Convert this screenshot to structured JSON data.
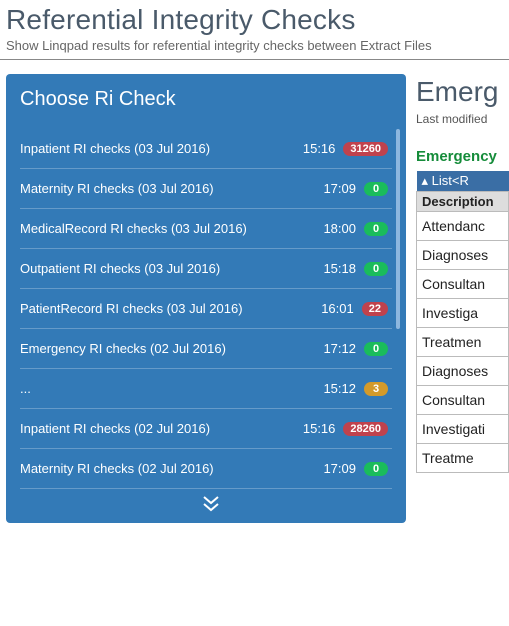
{
  "header": {
    "title": "Referential Integrity Checks",
    "subtitle": "Show Linqpad results for referential integrity checks between Extract Files"
  },
  "panel": {
    "title": "Choose Ri Check",
    "items": [
      {
        "label": "Inpatient RI checks (03 Jul 2016)",
        "time": "15:16",
        "count": "31260",
        "level": "red"
      },
      {
        "label": "Maternity RI checks (03 Jul 2016)",
        "time": "17:09",
        "count": "0",
        "level": "green"
      },
      {
        "label": "MedicalRecord RI checks (03 Jul 2016)",
        "time": "18:00",
        "count": "0",
        "level": "green"
      },
      {
        "label": "Outpatient RI checks (03 Jul 2016)",
        "time": "15:18",
        "count": "0",
        "level": "green"
      },
      {
        "label": "PatientRecord RI checks (03 Jul 2016)",
        "time": "16:01",
        "count": "22",
        "level": "red"
      },
      {
        "label": "Emergency RI checks (02 Jul 2016)",
        "time": "17:12",
        "count": "0",
        "level": "green"
      },
      {
        "label": "...",
        "time": "15:12",
        "count": "3",
        "level": "orange"
      },
      {
        "label": "Inpatient RI checks (02 Jul 2016)",
        "time": "15:16",
        "count": "28260",
        "level": "red"
      },
      {
        "label": "Maternity RI checks (02 Jul 2016)",
        "time": "17:09",
        "count": "0",
        "level": "green"
      }
    ]
  },
  "detail": {
    "title": "Emerg",
    "subtitle": "Last modified",
    "section": "Emergency",
    "grid": {
      "listHeader": "▴ List<R",
      "descHeader": "Description",
      "rows": [
        "Attendanc",
        "Diagnoses",
        "Consultan",
        "Investiga",
        "Treatmen",
        "Diagnoses",
        "Consultan",
        "Investigati",
        "Treatme"
      ]
    }
  }
}
